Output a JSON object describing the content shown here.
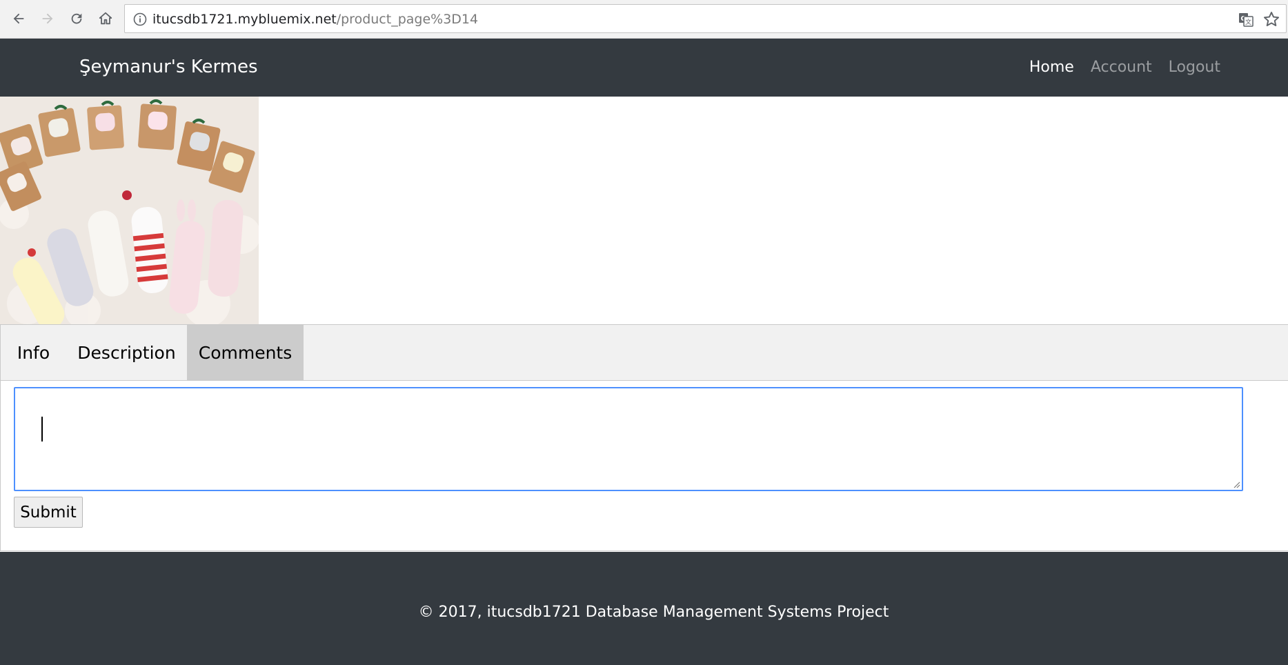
{
  "browser": {
    "url_host": "itucsdb1721.mybluemix.net",
    "url_path": "/product_page%3D14",
    "icons": [
      "back-arrow-icon",
      "forward-arrow-icon",
      "reload-icon",
      "home-icon",
      "info-icon",
      "translate-icon",
      "star-icon"
    ]
  },
  "navbar": {
    "brand": "Şeymanur's Kermes",
    "links": [
      {
        "label": "Home",
        "active": true
      },
      {
        "label": "Account",
        "active": false
      },
      {
        "label": "Logout",
        "active": false
      }
    ]
  },
  "product": {
    "image_icon": "product-photo-socks"
  },
  "tabs": [
    {
      "label": "Info",
      "active": false
    },
    {
      "label": "Description",
      "active": false
    },
    {
      "label": "Comments",
      "active": true
    }
  ],
  "comment_form": {
    "textarea_value": "",
    "submit_label": "Submit"
  },
  "footer": {
    "text": "© 2017, itucsdb1721 Database Management Systems Project"
  },
  "colors": {
    "navbar_bg": "#343a40",
    "link_active": "#ffffff",
    "link_inactive": "#9a9da0",
    "tab_active_bg": "#cccccc",
    "focus_border": "#4d90fe"
  }
}
